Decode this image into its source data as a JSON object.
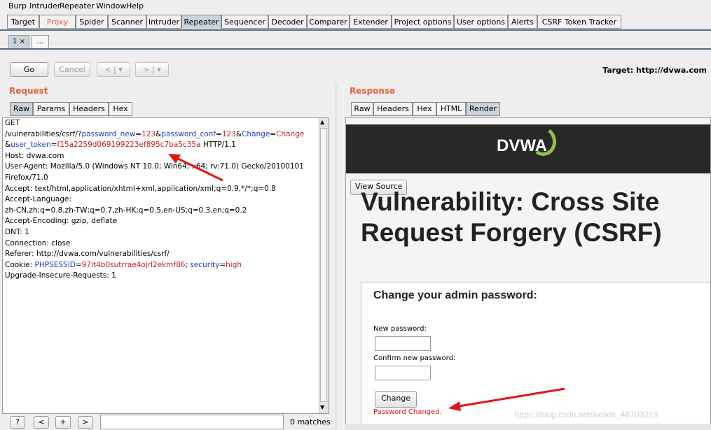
{
  "menu": [
    "Burp",
    "Intruder",
    "Repeater",
    "Window",
    "Help"
  ],
  "tool_tabs": [
    "Target",
    "Proxy",
    "Spider",
    "Scanner",
    "Intruder",
    "Repeater",
    "Sequencer",
    "Decoder",
    "Comparer",
    "Extender",
    "Project options",
    "User options",
    "Alerts",
    "CSRF Token Tracker"
  ],
  "active_tool_tab": "Repeater",
  "repeater_tabs": {
    "tab1": "1 ×",
    "more": "..."
  },
  "actions": {
    "go": "Go",
    "cancel": "Cancel",
    "back": "< | ▾",
    "forward": "> | ▾"
  },
  "target": "Target: http://dvwa.com",
  "request": {
    "title": "Request",
    "tabs": [
      "Raw",
      "Params",
      "Headers",
      "Hex"
    ],
    "lines": {
      "l1": "GET",
      "l2_path": "/vulnerabilities/csrf/?",
      "l2_p1": "password_new",
      "l2_eq1": "=",
      "l2_v1": "123",
      "l2_amp1": "&",
      "l2_p2": "password_conf",
      "l2_eq2": "=",
      "l2_v2": "123",
      "l2_amp2": "&",
      "l2_p3": "Change",
      "l2_eq3": "=",
      "l2_v3": "Change",
      "l3_amp": "&",
      "l3_p": "user_token",
      "l3_eq": "=",
      "l3_v": "f15a2259d069199223ef895c7ba5c35a",
      "l3_tail": " HTTP/1.1",
      "l4": "Host: dvwa.com",
      "l5": "User-Agent: Mozilla/5.0 (Windows NT 10.0; Win64; x64; rv:71.0) Gecko/20100101",
      "l6": "Firefox/71.0",
      "l7": "Accept: text/html,application/xhtml+xml,application/xml;q=0.9,*/*;q=0.8",
      "l8": "Accept-Language:",
      "l9": "zh-CN,zh;q=0.8,zh-TW;q=0.7,zh-HK;q=0.5,en-US;q=0.3,en;q=0.2",
      "l10": "Accept-Encoding: gzip, deflate",
      "l11": "DNT: 1",
      "l12": "Connection: close",
      "l13": "Referer: http://dvwa.com/vulnerabilities/csrf/",
      "l14_pre": "Cookie: ",
      "l14_p1": "PHPSESSID",
      "l14_eq1": "=",
      "l14_v1": "97lt4b0sutrrae4ojrl2ekmf86",
      "l14_sep": "; ",
      "l14_p2": "security",
      "l14_eq2": "=",
      "l14_v2": "high",
      "l15": "Upgrade-Insecure-Requests: 1"
    }
  },
  "search": {
    "help": "?",
    "prev": "<",
    "add": "+",
    "next": ">",
    "value": "",
    "matches": "0 matches"
  },
  "response": {
    "title": "Response",
    "tabs": [
      "Raw",
      "Headers",
      "Hex",
      "HTML",
      "Render"
    ],
    "active_tab": "Render",
    "render": {
      "logo": "DVWA",
      "view_source": "View Source",
      "heading": "Vulnerability: Cross Site Request Forgery (CSRF)",
      "form_title": "Change your admin password:",
      "new_password_label": "New password:",
      "confirm_password_label": "Confirm new password:",
      "change_button": "Change",
      "message": "Password Changed."
    }
  },
  "watermark": "https://blog.csdn.net/weixin_46709219",
  "colors": {
    "accent": "#e8603c",
    "param": "#1e3cc8",
    "value": "#c81e1e",
    "arrow": "#e01515",
    "logo_green": "#8dc34a"
  }
}
